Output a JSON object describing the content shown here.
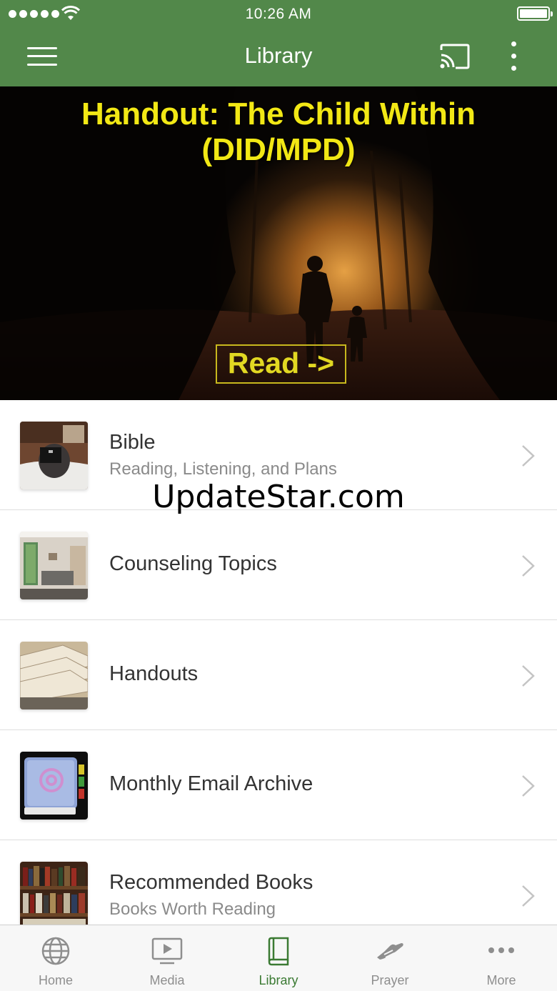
{
  "status_bar": {
    "time": "10:26 AM",
    "signal_icon": "signal-dots-icon",
    "wifi_icon": "wifi-icon",
    "battery_icon": "battery-icon"
  },
  "nav": {
    "title": "Library",
    "menu_icon": "hamburger-menu-icon",
    "cast_icon": "cast-icon",
    "more_icon": "vertical-ellipsis-icon"
  },
  "banner": {
    "title_line1": "Handout: The Child Within",
    "title_line2": "(DID/MPD)",
    "button_label": "Read ->",
    "title_color": "#f2e815"
  },
  "watermark": "UpdateStar.com",
  "library_items": [
    {
      "title": "Bible",
      "subtitle": "Reading, Listening, and Plans",
      "thumb": "person-reading-bible"
    },
    {
      "title": "Counseling Topics",
      "subtitle": "",
      "thumb": "counseling-room"
    },
    {
      "title": "Handouts",
      "subtitle": "",
      "thumb": "file-folders"
    },
    {
      "title": "Monthly Email Archive",
      "subtitle": "",
      "thumb": "email-address-book"
    },
    {
      "title": "Recommended Books",
      "subtitle": "Books Worth Reading",
      "thumb": "bookshelf"
    }
  ],
  "tabs": [
    {
      "label": "Home",
      "icon": "globe-icon",
      "active": false
    },
    {
      "label": "Media",
      "icon": "tv-play-icon",
      "active": false
    },
    {
      "label": "Library",
      "icon": "book-icon",
      "active": true
    },
    {
      "label": "Prayer",
      "icon": "praying-hands-icon",
      "active": false
    },
    {
      "label": "More",
      "icon": "horizontal-ellipsis-icon",
      "active": false
    }
  ],
  "colors": {
    "brand_green": "#52884a",
    "active_tab": "#3b7a33",
    "inactive_tab": "#8e8e8e"
  }
}
